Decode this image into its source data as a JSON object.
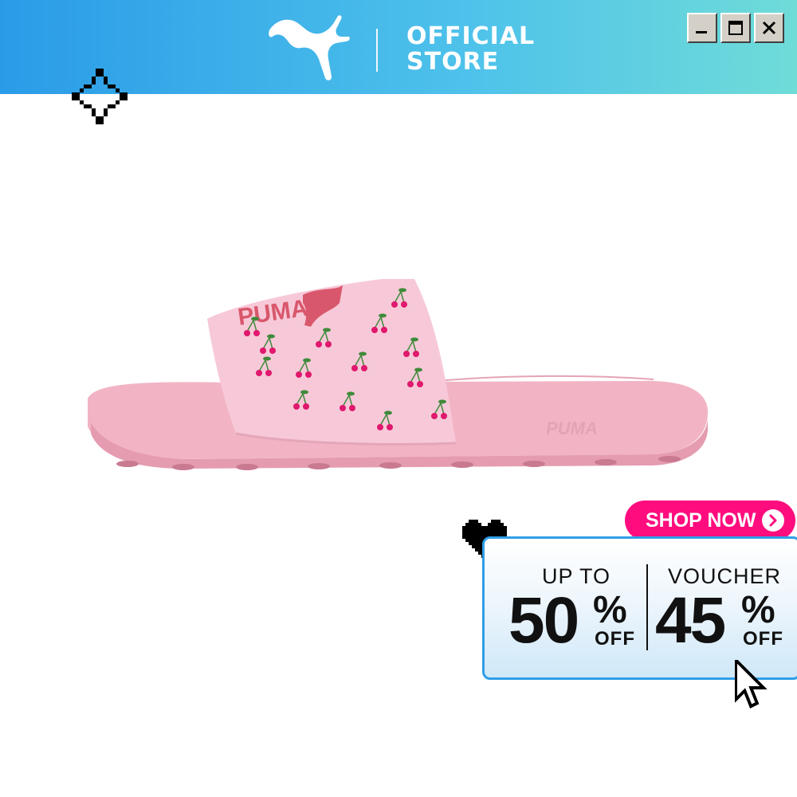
{
  "header": {
    "brand_line1": "OFFICIAL",
    "brand_line2": "STORE",
    "logo_icon": "puma-cat-icon",
    "colors": {
      "gradient_start": "#2a9be8",
      "gradient_end": "#6fdcd8"
    }
  },
  "window_controls": [
    "minimize-icon",
    "maximize-icon",
    "close-icon"
  ],
  "product": {
    "image_icon": "pink-slide-sandal-with-cherry-print",
    "colors": {
      "body": "#f3b8c8",
      "strap": "#f7c9d8",
      "cherry": "#e0186e",
      "leaf": "#3f8a3a"
    }
  },
  "promo": {
    "shop_now_label": "SHOP NOW",
    "left_caption": "UP TO",
    "left_value": "50",
    "right_caption": "VOUCHER",
    "right_value": "45",
    "percent_sign": "%",
    "off_label": "OFF",
    "colors": {
      "accent": "#ff0d7e",
      "border": "#2f9ee7"
    }
  }
}
